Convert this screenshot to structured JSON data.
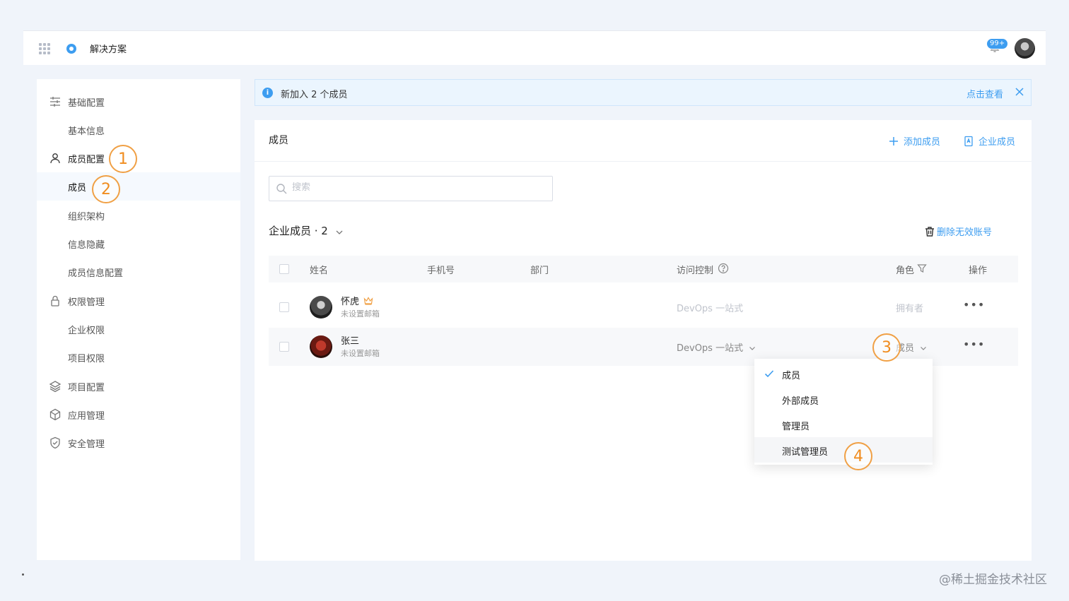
{
  "app": {
    "title": "解决方案",
    "notification_count": "99+"
  },
  "sidebar": {
    "items": [
      {
        "label": "基础配置",
        "icon": "sliders-icon"
      },
      {
        "label": "基本信息"
      },
      {
        "label": "成员配置",
        "icon": "user-icon"
      },
      {
        "label": "成员"
      },
      {
        "label": "组织架构"
      },
      {
        "label": "信息隐藏"
      },
      {
        "label": "成员信息配置"
      },
      {
        "label": "权限管理",
        "icon": "lock-icon"
      },
      {
        "label": "企业权限"
      },
      {
        "label": "项目权限"
      },
      {
        "label": "项目配置",
        "icon": "layers-icon"
      },
      {
        "label": "应用管理",
        "icon": "cube-icon"
      },
      {
        "label": "安全管理",
        "icon": "shield-icon"
      }
    ]
  },
  "annotations": [
    "1",
    "2",
    "3",
    "4"
  ],
  "alert": {
    "message": "新加入 2 个成员",
    "action": "点击查看"
  },
  "panel": {
    "title": "成员",
    "add_member": "添加成员",
    "enterprise_member": "企业成员",
    "search_placeholder": "搜索",
    "group_title": "企业成员 · 2",
    "delete_invalid": "删除无效账号"
  },
  "table": {
    "columns": [
      "姓名",
      "手机号",
      "部门",
      "访问控制",
      "角色",
      "操作"
    ],
    "rows": [
      {
        "name": "怀虎",
        "email": "未设置邮箱",
        "access": "DevOps 一站式",
        "role": "拥有者",
        "more": "•••"
      },
      {
        "name": "张三",
        "email": "未设置邮箱",
        "access": "DevOps 一站式",
        "role": "成员",
        "more": "•••"
      }
    ]
  },
  "role_dropdown": {
    "options": [
      "成员",
      "外部成员",
      "管理员",
      "测试管理员"
    ],
    "selected": "成员"
  },
  "watermark": "@稀土掘金技术社区",
  "colors": {
    "accent": "#3d9df0",
    "annotation": "#f08c1e"
  }
}
